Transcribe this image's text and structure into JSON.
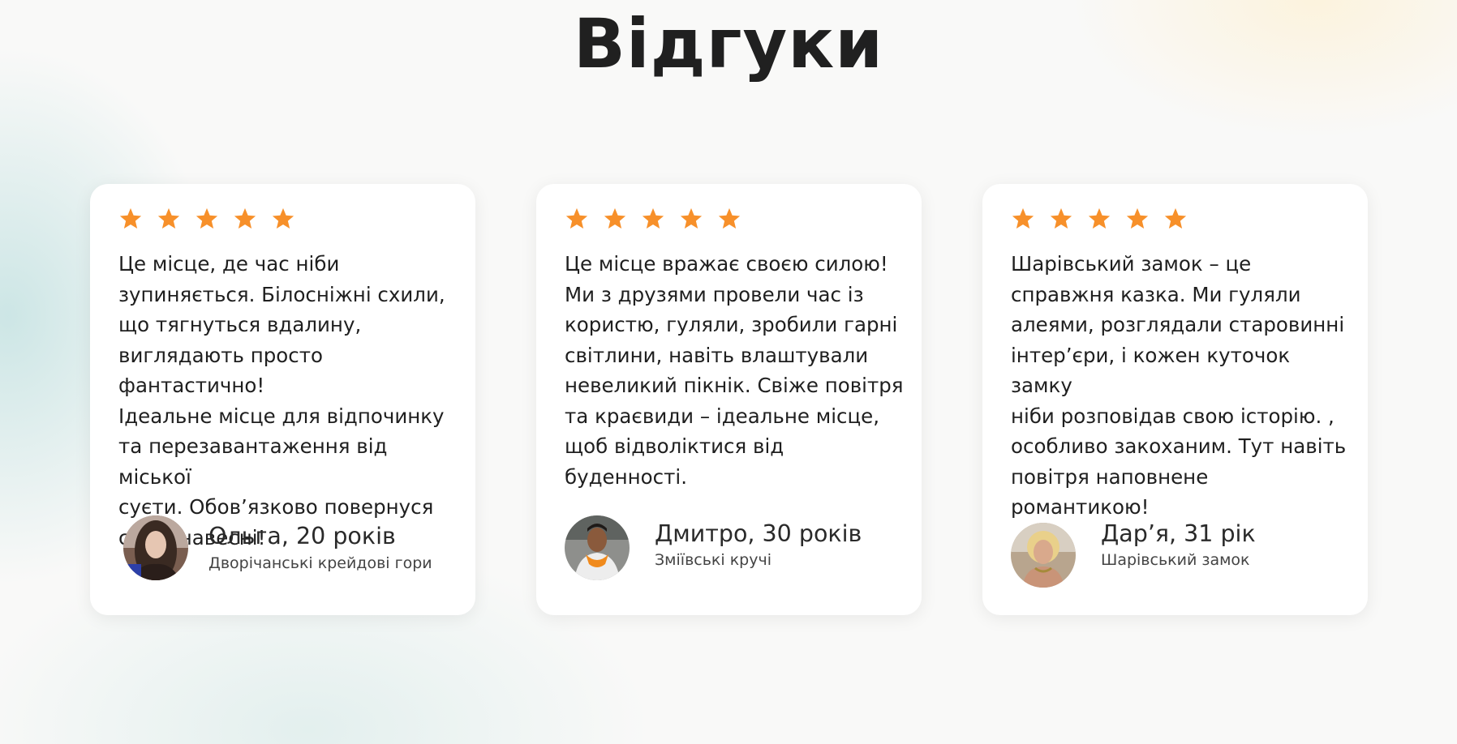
{
  "page": {
    "title": "Відгуки"
  },
  "colors": {
    "star": "#f7902a",
    "card_bg": "#ffffff",
    "heading": "#202020"
  },
  "reviews": [
    {
      "rating": 5,
      "text": "Це місце, де час ніби\nзупиняється. Білосніжні схили,\nщо тягнуться вдалину,\nвиглядають просто фантастично!\nІдеальне місце для  відпочинку\nта перезавантаження від міської\nсуєти. Обов’язково повернуся\nсюди навесні!",
      "author": "Ольга, 20 років",
      "place": "Дворічанські крейдові гори",
      "avatar_icon": "avatar-photo-woman-dark-hair"
    },
    {
      "rating": 5,
      "text": "Це місце вражає своєю силою!\nМи з друзями  провели час із\nкористю, гуляли, зробили гарні\nсвітлини, навіть влаштували\nневеликий пікнік. Свіже повітря\nта краєвиди – ідеальне місце,\nщоб відволіктися від буденності.",
      "author": "Дмитро, 30 років",
      "place": "Зміївські кручі",
      "avatar_icon": "avatar-photo-man-orange-hoodie"
    },
    {
      "rating": 5,
      "text": "Шарівський замок – це\nсправжня казка. Ми гуляли\nалеями, розглядали старовинні\nінтер’єри, і кожен куточок замку\nніби розповідав свою історію. ,\nособливо закоханим. Тут навіть\nповітря наповнене романтикою!",
      "author": "Дар’я, 31 рік",
      "place": "Шарівський замок",
      "avatar_icon": "avatar-photo-woman-blonde"
    }
  ]
}
